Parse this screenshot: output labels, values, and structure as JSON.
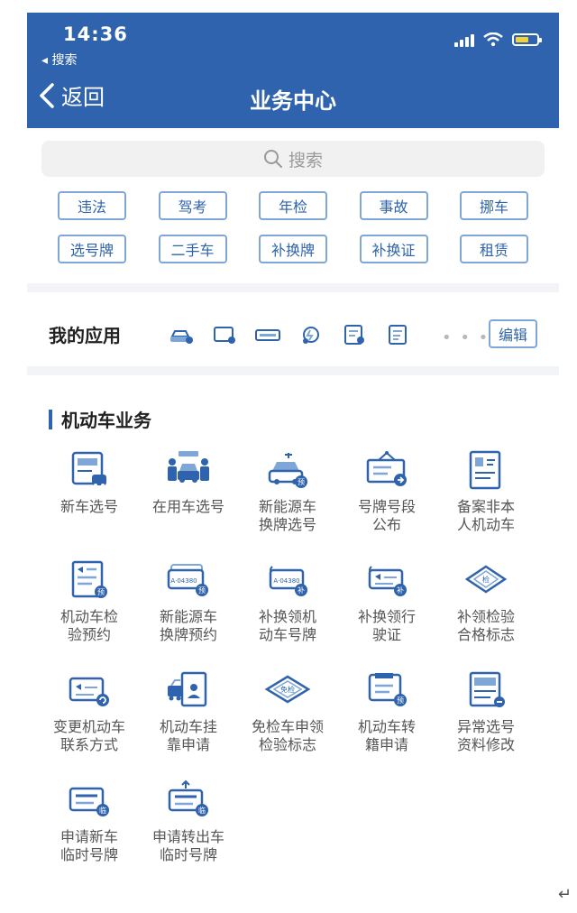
{
  "status_bar": {
    "time": "14:36",
    "back_app": "◂ 搜索"
  },
  "nav": {
    "back_label": "返回",
    "title": "业务中心"
  },
  "search": {
    "placeholder": "搜索"
  },
  "tags": [
    [
      "违法",
      "驾考",
      "年检",
      "事故",
      "挪车"
    ],
    [
      "选号牌",
      "二手车",
      "补换牌",
      "补换证",
      "租赁"
    ]
  ],
  "my_apps": {
    "title": "我的应用",
    "icons": [
      "car-icon",
      "screen-icon",
      "plate-icon",
      "ev-icon",
      "card-icon",
      "form-icon"
    ],
    "more": "• • •",
    "edit_label": "编辑"
  },
  "section": {
    "title": "机动车业务",
    "rows": [
      [
        {
          "label": "新车选号",
          "icon": "new-car-plate-icon"
        },
        {
          "label": "在用车选号",
          "icon": "people-car-icon"
        },
        {
          "label": "新能源车\n换牌选号",
          "icon": "ev-charging-icon"
        },
        {
          "label": "号牌号段\n公布",
          "icon": "announcement-board-icon"
        },
        {
          "label": "备案非本\n人机动车",
          "icon": "id-document-icon"
        }
      ],
      [
        {
          "label": "机动车检\n验预约",
          "icon": "inspection-appointment-icon"
        },
        {
          "label": "新能源车\n换牌预约",
          "icon": "ev-plate-appointment-icon"
        },
        {
          "label": "补换领机\n动车号牌",
          "icon": "plate-replacement-icon"
        },
        {
          "label": "补换领行\n驶证",
          "icon": "license-replacement-icon"
        },
        {
          "label": "补领检验\n合格标志",
          "icon": "inspection-sticker-icon"
        }
      ],
      [
        {
          "label": "变更机动车\n联系方式",
          "icon": "contact-change-icon"
        },
        {
          "label": "机动车挂\n靠申请",
          "icon": "affiliation-icon"
        },
        {
          "label": "免检车申领\n检验标志",
          "icon": "exempt-sticker-icon"
        },
        {
          "label": "机动车转\n籍申请",
          "icon": "transfer-icon"
        },
        {
          "label": "异常选号\n资料修改",
          "icon": "data-edit-icon"
        }
      ],
      [
        {
          "label": "申请新车\n临时号牌",
          "icon": "temporary-plate-icon"
        },
        {
          "label": "申请转出车\n临时号牌",
          "icon": "temporary-plate-out-icon"
        }
      ]
    ],
    "badge_texts": {
      "appointment": "预",
      "replace": "补",
      "temporary": "临",
      "exempt": "免检",
      "inspect": "检",
      "plate_text": "A·04380"
    }
  },
  "colors": {
    "primary": "#2f63ad",
    "tag_border": "#7ea6d6",
    "label": "#555555"
  },
  "footer_mark": "↵"
}
